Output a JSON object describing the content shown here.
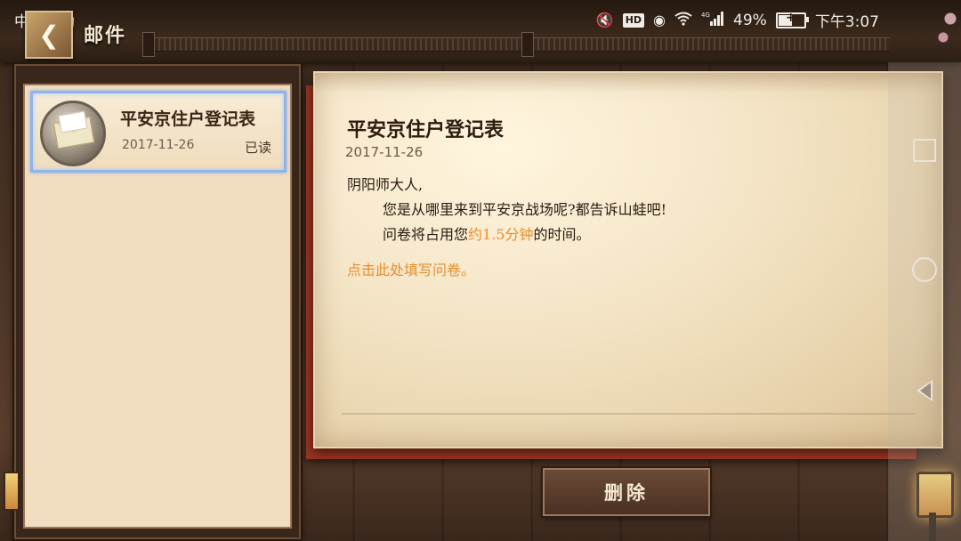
{
  "status_bar": {
    "carrier": "中国移动",
    "network": "4G",
    "battery": "49%",
    "battery_level": 0.49,
    "time": "下午3:07"
  },
  "header": {
    "title": "邮件"
  },
  "mail_list": {
    "items": [
      {
        "title": "平安京住户登记表",
        "date": "2017-11-26",
        "status": "已读"
      }
    ]
  },
  "letter": {
    "title": "平安京住户登记表",
    "date": "2017-11-26",
    "greeting": "阴阳师大人,",
    "line1": "您是从哪里来到平安京战场呢?都告诉山蛙吧!",
    "line2_prefix": "问卷将占用您",
    "line2_highlight": "约1.5分钟",
    "line2_suffix": "的时间。",
    "link_text": "点击此处填写问卷。"
  },
  "actions": {
    "delete_label": "删除"
  },
  "icons": {
    "back": "back-arrow-icon",
    "mail": "envelope-icon",
    "mute": "mute-icon",
    "eye": "eye-icon",
    "wifi": "wifi-icon",
    "signal": "signal-icon",
    "battery": "battery-icon",
    "nav_square": "recent-apps-icon",
    "nav_circle": "home-icon",
    "nav_back": "back-triangle-icon"
  },
  "colors": {
    "highlight": "#e88d2a",
    "selection_border": "#8fb4e8",
    "paper": "#f3e3c4"
  }
}
